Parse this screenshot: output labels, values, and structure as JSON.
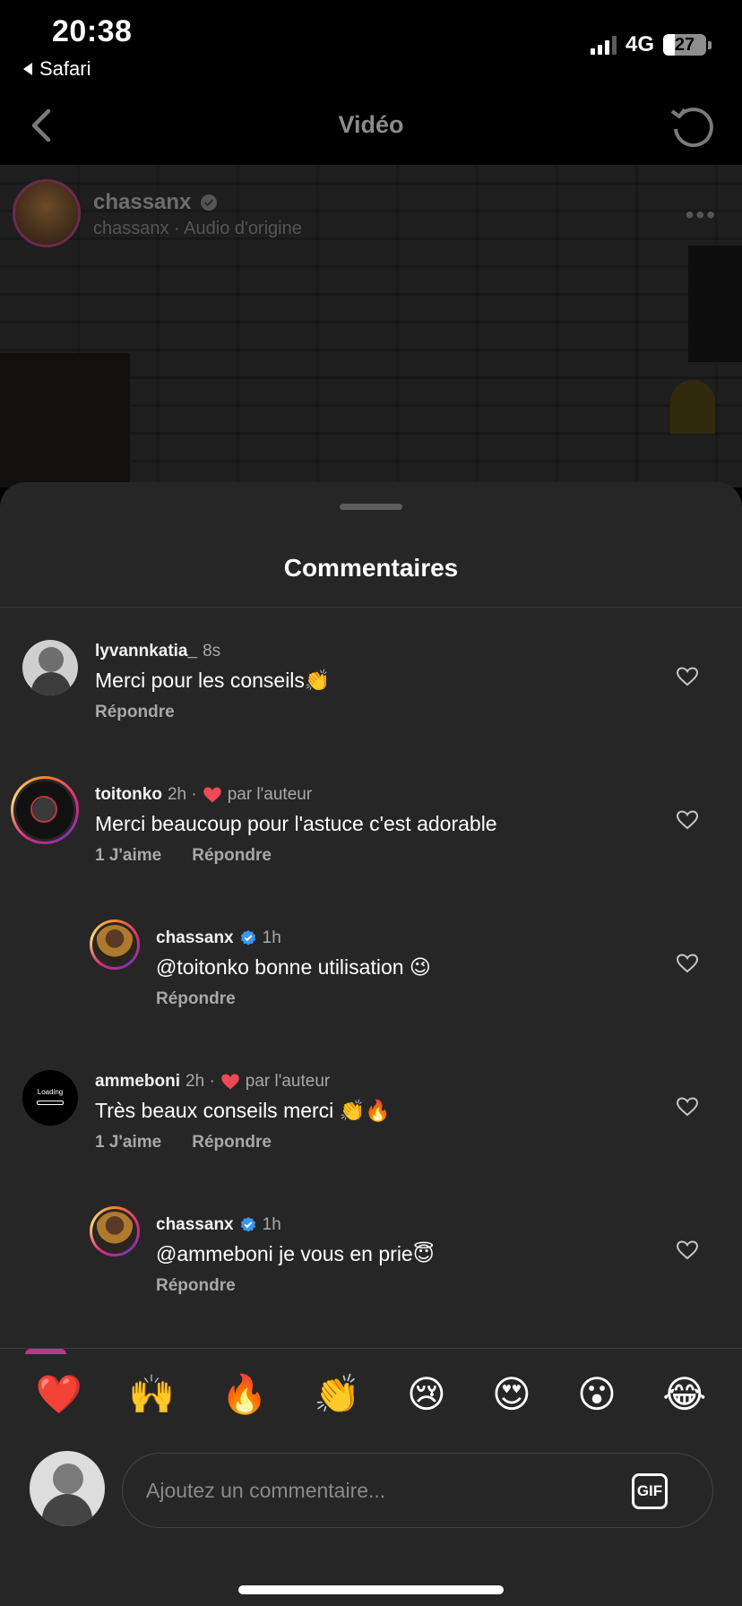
{
  "status_bar": {
    "time": "20:38",
    "back_app": "Safari",
    "network": "4G",
    "battery": "27",
    "battery_level": 0.27
  },
  "header": {
    "title": "Vidéo"
  },
  "video": {
    "username": "chassanx",
    "subtitle": "chassanx · Audio d'origine"
  },
  "sheet": {
    "title": "Commentaires"
  },
  "comments": [
    {
      "username": "lyvannkatia_",
      "time": "8s",
      "text": "Merci pour les conseils👏",
      "reply_label": "Répondre"
    },
    {
      "username": "toitonko",
      "time": "2h ·",
      "liked_by_author": "par l'auteur",
      "text": "Merci beaucoup pour l'astuce c'est adorable",
      "likes_label": "1 J'aime",
      "reply_label": "Répondre"
    },
    {
      "username": "chassanx",
      "time": "1h",
      "text": "@toitonko bonne utilisation 😉",
      "reply_label": "Répondre"
    },
    {
      "username": "ammeboni",
      "time": "2h ·",
      "liked_by_author": "par l'auteur",
      "text": "Très beaux conseils merci 👏🔥",
      "likes_label": "1 J'aime",
      "reply_label": "Répondre",
      "avatar_text": "Loading"
    },
    {
      "username": "chassanx",
      "time": "1h",
      "text": "@ammeboni je vous en prie😇",
      "reply_label": "Répondre"
    }
  ],
  "emoji_bar": [
    "❤️",
    "🙌",
    "🔥",
    "👏",
    "😢",
    "😍",
    "😮",
    "😂"
  ],
  "composer": {
    "placeholder": "Ajoutez un commentaire...",
    "gif_label": "GIF"
  },
  "colors": {
    "sheet_bg": "#262626",
    "verified": "#3897f0",
    "heart_red": "#ed4956"
  }
}
